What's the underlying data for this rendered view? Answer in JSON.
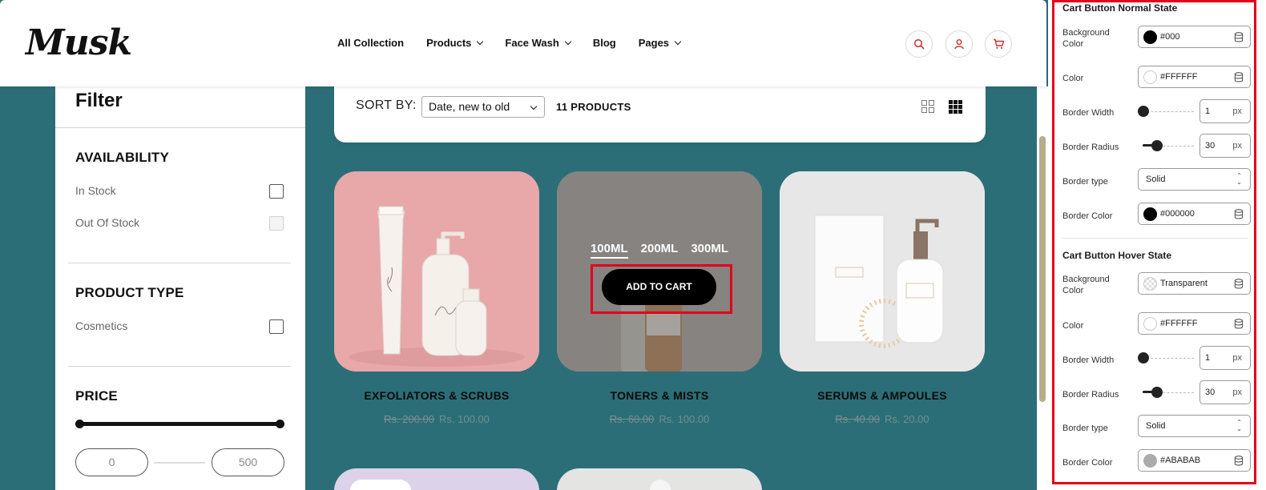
{
  "header": {
    "logo": "Musk",
    "nav": [
      {
        "label": "All Collection",
        "dropdown": false
      },
      {
        "label": "Products",
        "dropdown": true
      },
      {
        "label": "Face Wash",
        "dropdown": true
      },
      {
        "label": "Blog",
        "dropdown": false
      },
      {
        "label": "Pages",
        "dropdown": true
      }
    ],
    "icons": [
      "search-icon",
      "user-icon",
      "cart-icon"
    ],
    "accent_color": "#c9302c"
  },
  "filter": {
    "title": "Filter",
    "availability": {
      "heading": "AVAILABILITY",
      "options": [
        {
          "label": "In Stock",
          "enabled": true
        },
        {
          "label": "Out Of Stock",
          "enabled": false
        }
      ]
    },
    "product_type": {
      "heading": "PRODUCT TYPE",
      "options": [
        {
          "label": "Cosmetics",
          "enabled": true
        }
      ]
    },
    "price": {
      "heading": "PRICE",
      "min": "0",
      "max": "500"
    }
  },
  "sort": {
    "label": "SORT BY:",
    "selected": "Date, new to old",
    "product_count": "11 PRODUCTS"
  },
  "products": [
    {
      "title": "EXFOLIATORS & SCRUBS",
      "old_price": "Rs. 200.00",
      "new_price": "Rs. 100.00",
      "bg": "#e9a9aa"
    },
    {
      "title": "TONERS & MISTS",
      "old_price": "Rs. 60.00",
      "new_price": "Rs. 100.00",
      "bg": "#a6a39c",
      "hovered": true,
      "variants": [
        "100ML",
        "200ML",
        "300ML"
      ],
      "cta": "ADD TO CART"
    },
    {
      "title": "SERUMS & AMPOULES",
      "old_price": "Rs. 40.00",
      "new_price": "Rs. 20.00",
      "bg": "#e6e6e6"
    }
  ],
  "settings": {
    "normal": {
      "heading": "Cart Button Normal State",
      "labels": {
        "bg": "Background Color",
        "color": "Color",
        "border_width": "Border Width",
        "border_radius": "Border Radius",
        "border_type": "Border type",
        "border_color": "Border Color"
      },
      "bg_value": "#000",
      "bg_swatch": "#000000",
      "color_value": "#FFFFFF",
      "color_swatch": "#ffffff",
      "border_width": "1",
      "border_radius": "30",
      "unit": "px",
      "border_type": "Solid",
      "border_color_value": "#000000",
      "border_color_swatch": "#000000"
    },
    "hover": {
      "heading": "Cart Button Hover State",
      "labels": {
        "bg": "Background Color",
        "color": "Color",
        "border_width": "Border Width",
        "border_radius": "Border Radius",
        "border_type": "Border type",
        "border_color": "Border Color"
      },
      "bg_value": "Transparent",
      "color_value": "#FFFFFF",
      "color_swatch": "#ffffff",
      "border_width": "1",
      "border_radius": "30",
      "unit": "px",
      "border_type": "Solid",
      "border_color_value": "#ABABAB",
      "border_color_swatch": "#ababab"
    }
  }
}
